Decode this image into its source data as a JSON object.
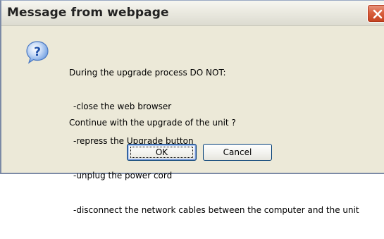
{
  "dialog": {
    "title": "Message from webpage",
    "icon": "question-icon",
    "message_lines": [
      "During the upgrade process DO NOT:",
      "-close the web browser",
      "-repress the Upgrade button",
      "-unplug the power cord",
      "-disconnect the network cables between the computer and the unit"
    ],
    "question": "Continue with the upgrade of the unit ?",
    "ok_label": "OK",
    "cancel_label": "Cancel",
    "close_icon": "close-icon",
    "accent_close": "#d9603f",
    "icon_color": "#2f6fd6"
  }
}
